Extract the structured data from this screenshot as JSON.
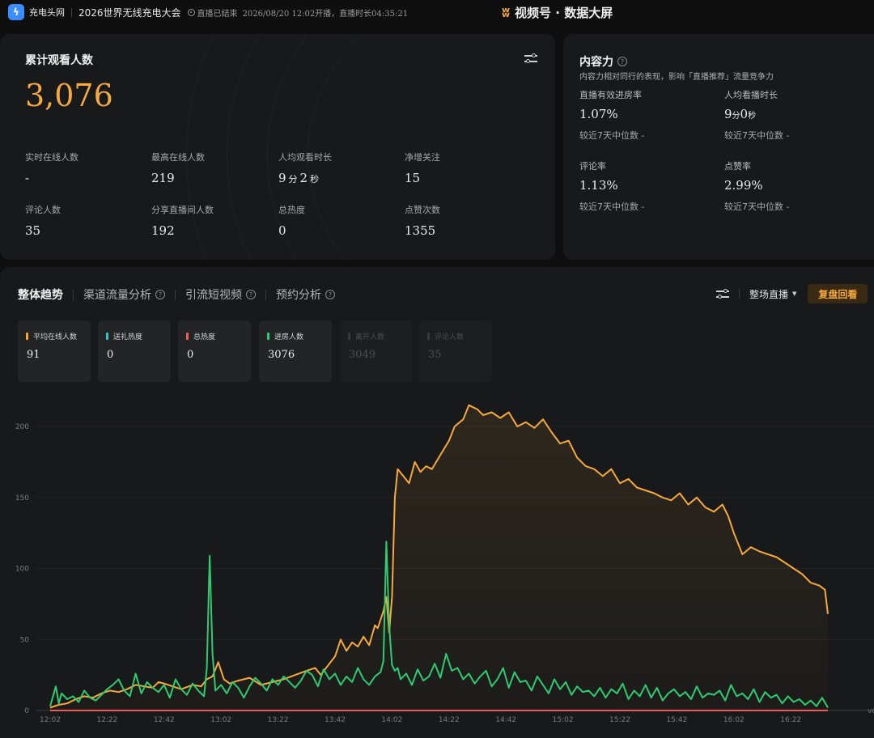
{
  "header": {
    "brand": "充电头网",
    "live_title": "2026世界无线充电大会",
    "status": "直播已结束",
    "meta": "2026/08/20 12:02开播，直播时长04:35:21",
    "center_title": "视频号 · 数据大屏"
  },
  "overview": {
    "title": "累计观看人数",
    "total": "3,076",
    "stats": [
      {
        "label": "实时在线人数",
        "value": "-"
      },
      {
        "label": "最高在线人数",
        "value": "219"
      },
      {
        "label": "人均观看时长",
        "value_min": "9",
        "unit_min": "分",
        "value_sec": "2",
        "unit_sec": "秒"
      },
      {
        "label": "净增关注",
        "value": "15"
      },
      {
        "label": "评论人数",
        "value": "35"
      },
      {
        "label": "分享直播间人数",
        "value": "192"
      },
      {
        "label": "总热度",
        "value": "0"
      },
      {
        "label": "点赞次数",
        "value": "1355"
      }
    ]
  },
  "content": {
    "title": "内容力",
    "subtitle": "内容力相对同行的表现，影响「直播推荐」流量竞争力",
    "metrics": [
      {
        "label": "直播有效进房率",
        "value": "1.07%",
        "median": "较近7天中位数 -"
      },
      {
        "label": "人均看播时长",
        "value_min": "9",
        "unit_min": "分",
        "value_sec": "0",
        "unit_sec": "秒",
        "median": "较近7天中位数 -"
      },
      {
        "label": "评论率",
        "value": "1.13%",
        "median": "较近7天中位数 -"
      },
      {
        "label": "点赞率",
        "value": "2.99%",
        "median": "较近7天中位数 -"
      }
    ]
  },
  "trend": {
    "tabs": [
      "整体趋势",
      "渠道流量分析",
      "引流短视频",
      "预约分析"
    ],
    "dropdown": "整场直播",
    "replay_button": "复盘回看",
    "metric_cards": [
      {
        "label": "平均在线人数",
        "value": "91",
        "color": "#f7a93b",
        "active": true
      },
      {
        "label": "送礼热度",
        "value": "0",
        "color": "#35c5d0",
        "active": true
      },
      {
        "label": "总热度",
        "value": "0",
        "color": "#f05a5a",
        "active": true
      },
      {
        "label": "进房人数",
        "value": "3076",
        "color": "#2ecc71",
        "active": true
      },
      {
        "label": "离开人数",
        "value": "3049",
        "color": "#3a3a3a",
        "active": false
      },
      {
        "label": "评论人数",
        "value": "35",
        "color": "#3a3a3a",
        "active": false
      }
    ]
  },
  "chart_data": {
    "type": "line",
    "ylim": [
      0,
      200
    ],
    "y_ticks": [
      "0",
      "50",
      "100",
      "150",
      "200"
    ],
    "x_ticks": [
      "12:02",
      "12:22",
      "12:42",
      "13:02",
      "13:22",
      "13:42",
      "14:02",
      "14:22",
      "14:42",
      "15:02",
      "15:22",
      "15:42",
      "16:02",
      "16:22"
    ],
    "x_minutes": [
      0,
      20,
      40,
      60,
      80,
      100,
      120,
      140,
      160,
      180,
      200,
      220,
      240,
      260
    ],
    "x_end_minute": 275,
    "x_end_label": "vo",
    "series": [
      {
        "color": "#f7a93b",
        "x": [
          0,
          3,
          6,
          9,
          12,
          15,
          18,
          21,
          24,
          27,
          30,
          33,
          36,
          38,
          40,
          43,
          46,
          50,
          53,
          55,
          57,
          59,
          61,
          63,
          66,
          70,
          74,
          78,
          82,
          86,
          90,
          93,
          95,
          98,
          100,
          102,
          104,
          106,
          108,
          110,
          112,
          114,
          115,
          117,
          118,
          119,
          120,
          121,
          122,
          124,
          126,
          128,
          130,
          132,
          134,
          137,
          140,
          142,
          145,
          147,
          150,
          152,
          155,
          158,
          161,
          164,
          167,
          170,
          173,
          176,
          179,
          182,
          185,
          188,
          191,
          194,
          197,
          200,
          203,
          206,
          209,
          212,
          215,
          218,
          221,
          224,
          227,
          230,
          233,
          236,
          238,
          240,
          243,
          246,
          249,
          252,
          255,
          258,
          261,
          264,
          267,
          270,
          272,
          273
        ],
        "values": [
          2,
          4,
          5,
          8,
          10,
          9,
          12,
          14,
          13,
          15,
          18,
          17,
          16,
          20,
          19,
          17,
          15,
          18,
          17,
          22,
          24,
          34,
          22,
          19,
          21,
          23,
          18,
          20,
          22,
          25,
          28,
          30,
          25,
          33,
          38,
          50,
          42,
          48,
          45,
          52,
          46,
          60,
          58,
          70,
          80,
          55,
          80,
          150,
          170,
          165,
          160,
          175,
          168,
          172,
          170,
          180,
          190,
          200,
          205,
          215,
          212,
          208,
          210,
          206,
          210,
          200,
          203,
          199,
          205,
          196,
          188,
          190,
          178,
          172,
          170,
          165,
          170,
          160,
          163,
          157,
          155,
          153,
          150,
          148,
          153,
          145,
          150,
          143,
          140,
          145,
          137,
          125,
          110,
          115,
          112,
          110,
          108,
          104,
          100,
          96,
          90,
          88,
          85,
          68
        ],
        "fill": true
      },
      {
        "color": "#2ecc71",
        "x": [
          0,
          2,
          3,
          4,
          6,
          8,
          10,
          12,
          14,
          16,
          18,
          20,
          22,
          24,
          26,
          28,
          30,
          32,
          34,
          36,
          38,
          40,
          42,
          44,
          46,
          48,
          50,
          52,
          54,
          55,
          56,
          57,
          58,
          60,
          62,
          64,
          66,
          68,
          70,
          72,
          74,
          76,
          78,
          80,
          82,
          84,
          86,
          88,
          90,
          92,
          94,
          96,
          98,
          100,
          102,
          104,
          106,
          108,
          110,
          112,
          114,
          116,
          117,
          118,
          119,
          120,
          121,
          122,
          123,
          125,
          127,
          129,
          131,
          133,
          135,
          137,
          139,
          141,
          143,
          145,
          147,
          149,
          151,
          153,
          155,
          157,
          159,
          161,
          163,
          165,
          167,
          169,
          171,
          173,
          175,
          177,
          179,
          181,
          183,
          185,
          187,
          189,
          191,
          193,
          195,
          197,
          199,
          201,
          203,
          205,
          207,
          209,
          211,
          213,
          215,
          217,
          219,
          221,
          223,
          225,
          227,
          229,
          231,
          233,
          235,
          237,
          239,
          241,
          243,
          245,
          247,
          249,
          251,
          253,
          255,
          257,
          259,
          261,
          263,
          265,
          267,
          269,
          271,
          273
        ],
        "values": [
          3,
          17,
          5,
          12,
          8,
          10,
          6,
          14,
          9,
          7,
          11,
          15,
          18,
          22,
          14,
          10,
          26,
          12,
          20,
          16,
          13,
          18,
          9,
          22,
          15,
          11,
          19,
          14,
          10,
          30,
          109,
          40,
          14,
          18,
          12,
          20,
          16,
          9,
          17,
          23,
          19,
          14,
          22,
          18,
          24,
          20,
          16,
          21,
          28,
          25,
          17,
          29,
          22,
          26,
          18,
          24,
          20,
          30,
          22,
          18,
          24,
          27,
          35,
          119,
          60,
          32,
          28,
          30,
          22,
          26,
          18,
          29,
          21,
          24,
          33,
          23,
          40,
          28,
          30,
          22,
          26,
          19,
          24,
          28,
          17,
          22,
          30,
          16,
          27,
          20,
          21,
          14,
          24,
          18,
          12,
          22,
          15,
          20,
          11,
          17,
          13,
          14,
          10,
          16,
          9,
          15,
          12,
          19,
          8,
          14,
          10,
          18,
          9,
          16,
          7,
          12,
          15,
          10,
          13,
          8,
          17,
          9,
          12,
          11,
          14,
          7,
          18,
          10,
          12,
          8,
          15,
          6,
          13,
          9,
          11,
          5,
          10,
          6,
          8,
          4,
          7,
          3,
          9,
          2
        ],
        "fill": false
      },
      {
        "color": "#f05a5a",
        "x": [
          0,
          273
        ],
        "values": [
          0,
          0
        ],
        "fill": false
      }
    ]
  }
}
